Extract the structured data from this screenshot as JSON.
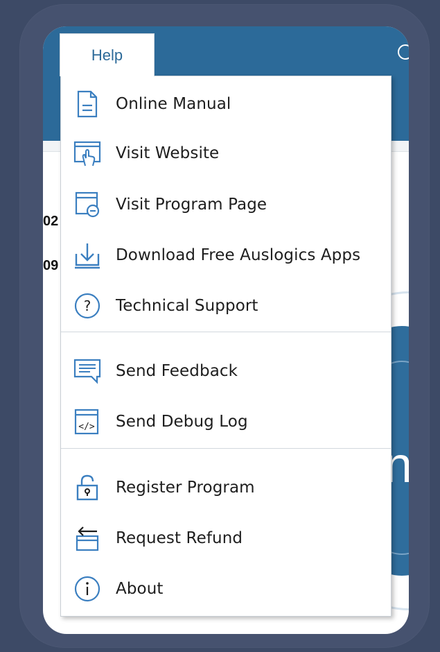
{
  "menu": {
    "tab_label": "Help",
    "groups": [
      [
        {
          "label": "Online Manual",
          "icon": "document-icon"
        },
        {
          "label": "Visit Website",
          "icon": "web-click-icon"
        },
        {
          "label": "Visit Program Page",
          "icon": "program-page-icon"
        },
        {
          "label": "Download Free Auslogics Apps",
          "icon": "download-icon"
        },
        {
          "label": "Technical Support",
          "icon": "question-circle-icon"
        }
      ],
      [
        {
          "label": "Send Feedback",
          "icon": "feedback-icon"
        },
        {
          "label": "Send Debug Log",
          "icon": "debug-log-icon"
        }
      ],
      [
        {
          "label": "Register Program",
          "icon": "lock-icon"
        },
        {
          "label": "Request Refund",
          "icon": "refund-icon"
        },
        {
          "label": "About",
          "icon": "info-icon"
        }
      ]
    ]
  },
  "background": {
    "text_row_1": "02",
    "text_row_2": "09",
    "disk_letter": "n"
  },
  "colors": {
    "accent": "#2c6a99",
    "icon_blue": "#3b7fc0",
    "page_bg": "#3d4a66"
  }
}
